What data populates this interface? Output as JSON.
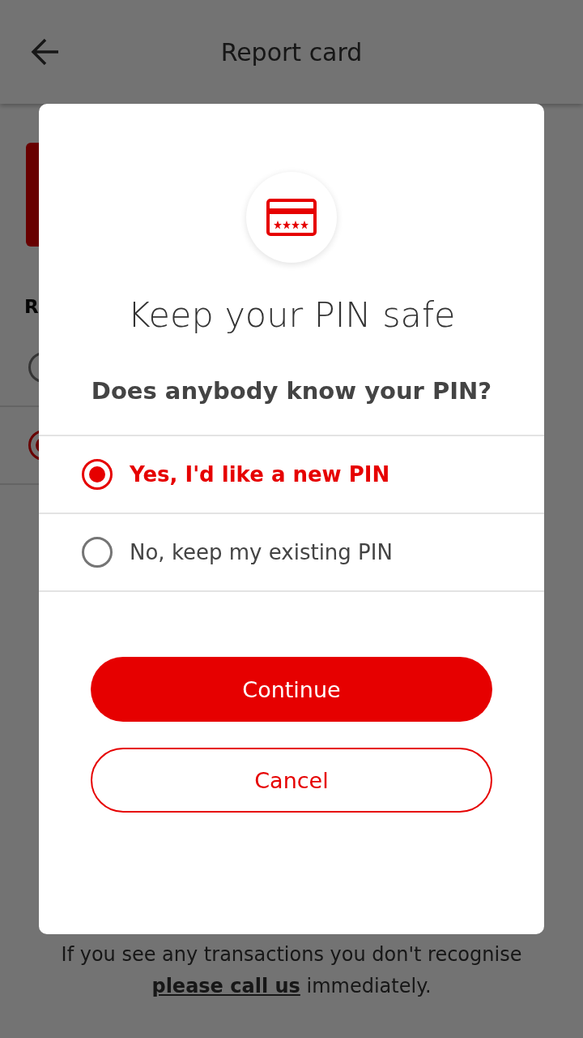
{
  "app_bar": {
    "title": "Report card"
  },
  "background": {
    "section_heading": "R",
    "options": [
      {
        "selected": false
      },
      {
        "selected": true
      }
    ],
    "footer_text": "If you see any transactions you don't recognise",
    "footer_link": "please call us",
    "footer_end": " immediately."
  },
  "dialog": {
    "title": "Keep your PIN safe",
    "question": "Does anybody know your PIN?",
    "options": [
      {
        "label": "Yes, I'd like a new PIN",
        "selected": true
      },
      {
        "label": "No, keep my existing PIN",
        "selected": false
      }
    ],
    "buttons": [
      {
        "label": "Continue",
        "kind": "primary"
      },
      {
        "label": "Cancel",
        "kind": "secondary"
      }
    ]
  }
}
